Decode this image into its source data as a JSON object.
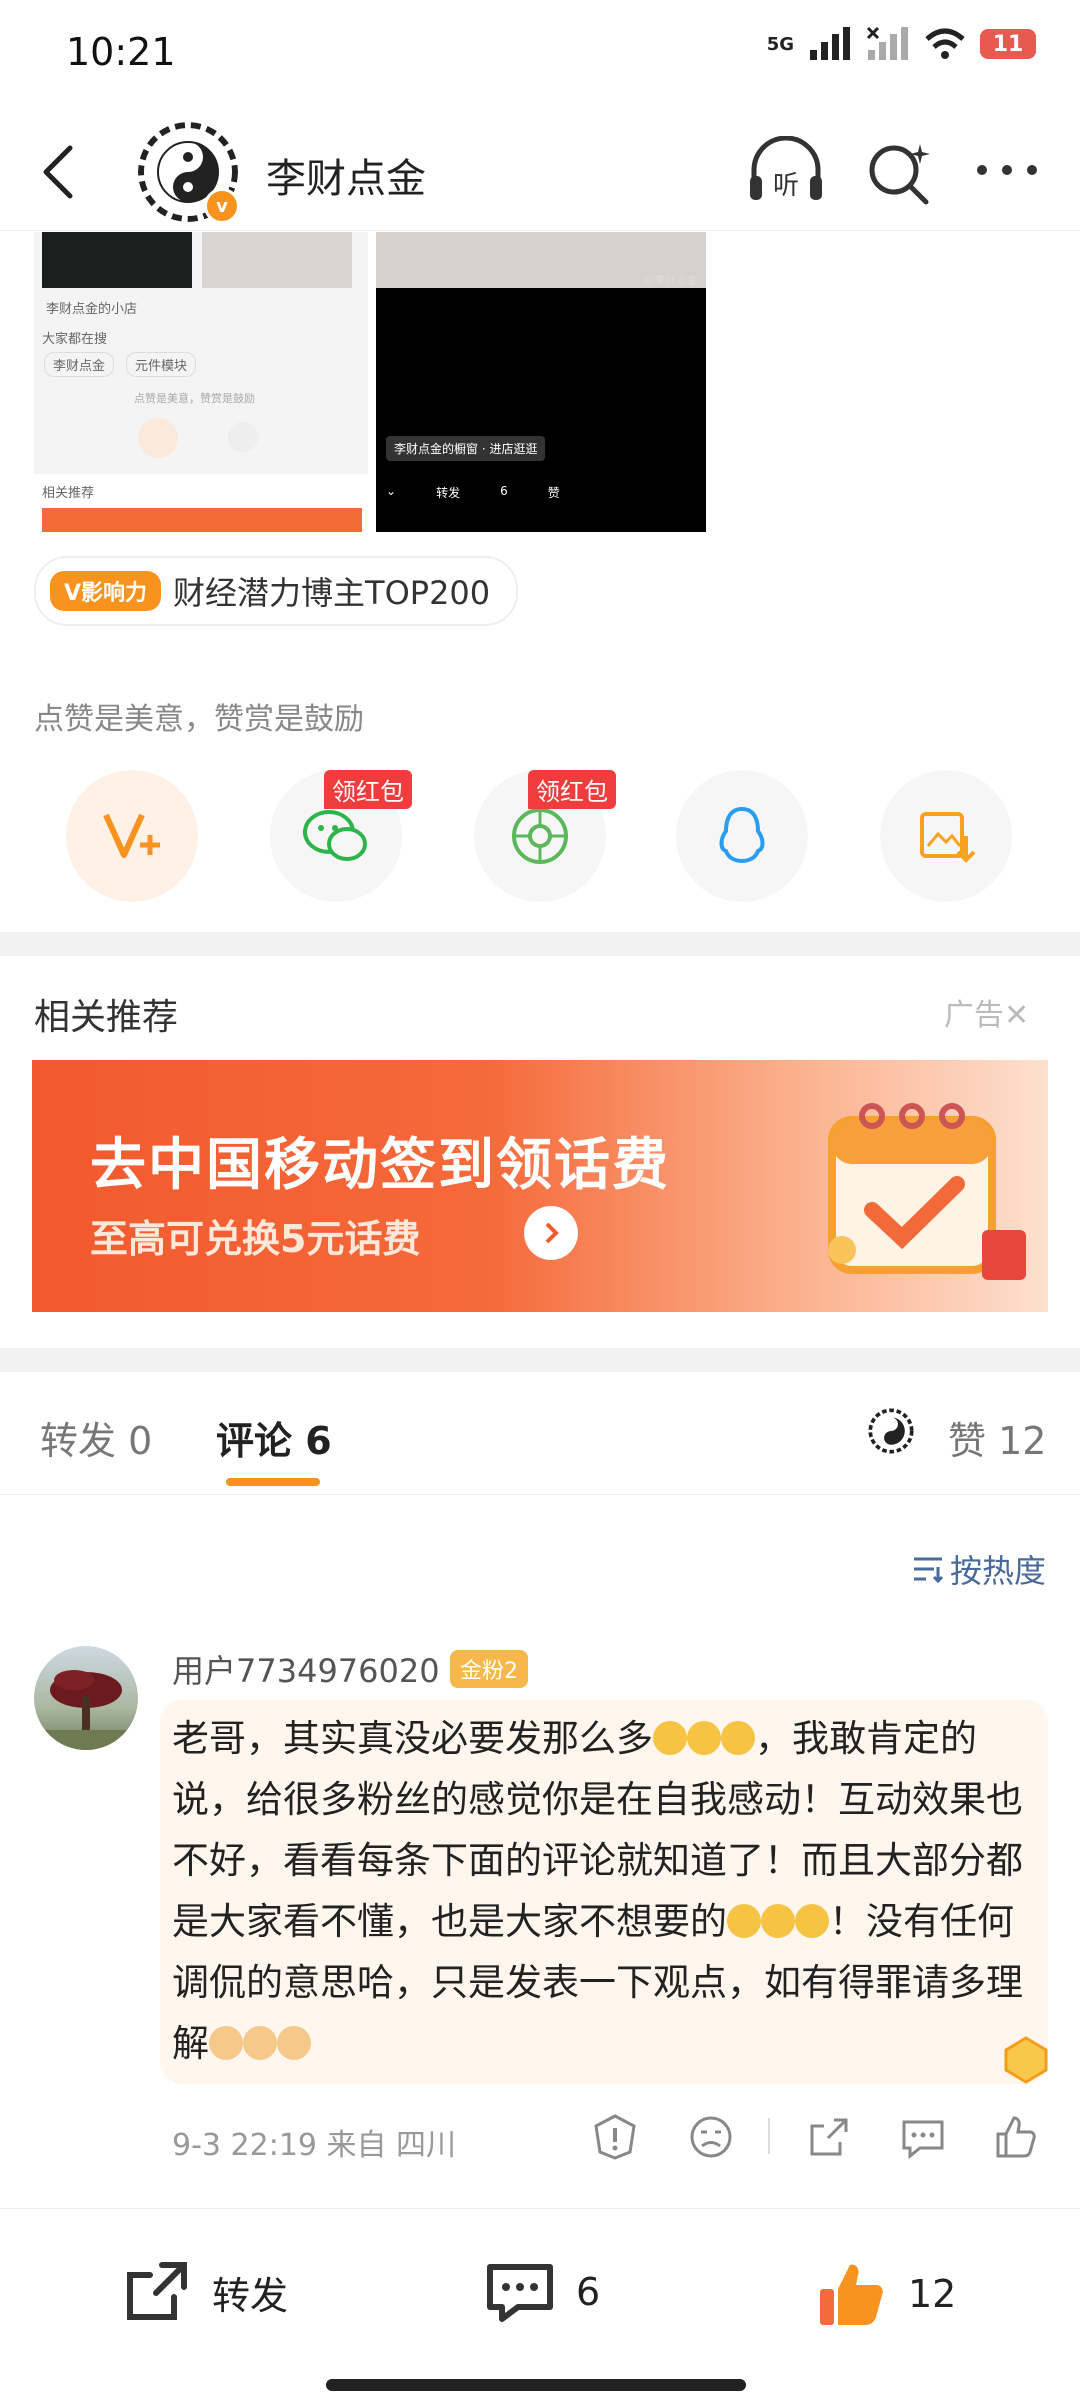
{
  "status_bar": {
    "time": "10:21",
    "battery": "11",
    "network": "5G"
  },
  "nav": {
    "title": "李财点金"
  },
  "images": {
    "left": {
      "shop_text": "李财点金的小店",
      "searching_label": "大家都在搜",
      "chip1": "李财点金",
      "chip2": "元件模块",
      "tip": "点赞是美意，赞赏是鼓励",
      "rec_label": "相关推荐"
    },
    "right": {
      "watermark": "@李财点金",
      "caption": "李财点金的橱窗 · 进店逛逛",
      "repost": "转发",
      "comments": "6",
      "like": "赞"
    }
  },
  "tag": {
    "badge": "V影响力",
    "text": "财经潜力博主TOP200"
  },
  "reward": {
    "tip": "点赞是美意，赞赏是鼓励",
    "share_targets": [
      {
        "name": "reward",
        "icon": "v-plus-icon",
        "color": "#f7931e"
      },
      {
        "name": "wechat",
        "icon": "wechat-icon",
        "color": "#2db44a",
        "badge": "领红包"
      },
      {
        "name": "moments",
        "icon": "moments-icon",
        "color": "#5cb85c",
        "badge": "领红包"
      },
      {
        "name": "qq",
        "icon": "qq-icon",
        "color": "#2b9df0"
      },
      {
        "name": "save-image",
        "icon": "save-image-icon",
        "color": "#f7a21e"
      }
    ]
  },
  "recommend": {
    "title": "相关推荐",
    "ad_label": "广告",
    "banner_title": "去中国移动签到领话费",
    "banner_sub": "至高可兑换5元话费"
  },
  "tabs": {
    "repost": "转发 0",
    "comment": "评论 6",
    "like": "赞 12"
  },
  "sort": "按热度",
  "comment": {
    "user": "用户7734976020",
    "fan_badge": "金粉2",
    "text_parts": [
      "老哥，其实真没必要发那么多",
      "，我敢肯定的说，给很多粉丝的感觉你是在自我感动！互动效果也不好，看看每条下面的评论就知道了！而且大部分都是大家看不懂，也是大家不想要的",
      "！没有任何调侃的意思哈，只是发表一下观点，如有得罪请多理解"
    ],
    "meta": "9-3 22:19  来自 四川"
  },
  "bottom": {
    "repost": "转发",
    "comments": "6",
    "likes": "12"
  },
  "colors": {
    "accent": "#f7931e",
    "link": "#4a6a9a",
    "red": "#f03c3c"
  }
}
